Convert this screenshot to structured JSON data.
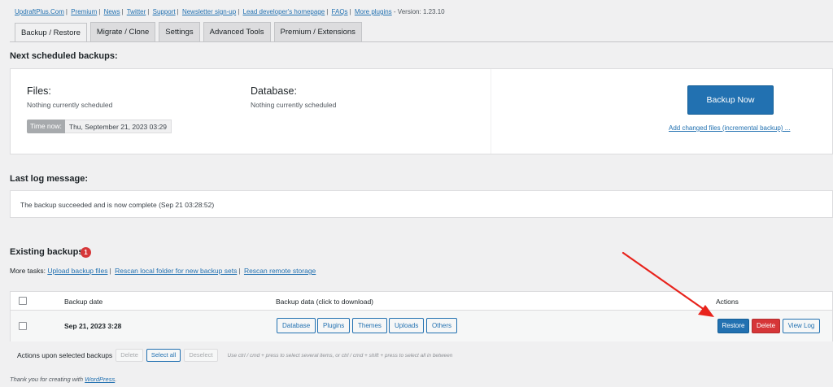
{
  "toplinks": {
    "items": [
      "UpdraftPlus.Com",
      "Premium",
      "News",
      "Twitter",
      "Support",
      "Newsletter sign-up",
      "Lead developer's homepage",
      "FAQs",
      "More plugins"
    ],
    "version": "- Version: 1.23.10"
  },
  "tabs": [
    "Backup / Restore",
    "Migrate / Clone",
    "Settings",
    "Advanced Tools",
    "Premium / Extensions"
  ],
  "scheduled": {
    "heading": "Next scheduled backups:",
    "files_title": "Files:",
    "files_status": "Nothing currently scheduled",
    "database_title": "Database:",
    "database_status": "Nothing currently scheduled",
    "time_label": "Time now:",
    "time_value": "Thu, September 21, 2023 03:29",
    "backup_now": "Backup Now",
    "incremental_link": "Add changed files (incremental backup) ..."
  },
  "log": {
    "heading": "Last log message:",
    "message": "The backup succeeded and is now complete (Sep 21 03:28:52)"
  },
  "existing": {
    "heading": "Existing backups",
    "count": "1",
    "more_tasks_label": "More tasks:",
    "links": [
      "Upload backup files",
      "Rescan local folder for new backup sets",
      "Rescan remote storage"
    ]
  },
  "table": {
    "columns": [
      "Backup date",
      "Backup data (click to download)",
      "Actions"
    ],
    "rows": [
      {
        "date": "Sep 21, 2023 3:28",
        "data_buttons": [
          "Database",
          "Plugins",
          "Themes",
          "Uploads",
          "Others"
        ],
        "actions": [
          "Restore",
          "Delete",
          "View Log"
        ]
      }
    ]
  },
  "bulk": {
    "label": "Actions upon selected backups",
    "delete": "Delete",
    "select_all": "Select all",
    "deselect": "Deselect",
    "hint": "Use ctrl / cmd + press to select several items, or ctrl / cmd + shift + press to select all in between"
  },
  "footer": {
    "text": "Thank you for creating with",
    "link": "WordPress",
    "end": "."
  },
  "colors": {
    "primary": "#2271b1",
    "danger": "#d63638",
    "annotation_arrow": "#e8231c"
  }
}
